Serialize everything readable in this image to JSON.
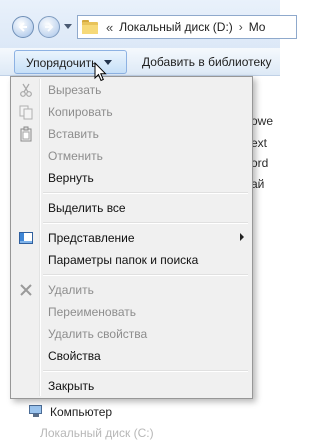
{
  "address": {
    "chevrons": "«",
    "disk_label": "Локальный диск (D:)",
    "arrow": "›",
    "next_partial": "Mo"
  },
  "toolbar": {
    "organize_label": "Упорядочить",
    "library_label": "Добавить в библиотеку"
  },
  "menu": {
    "cut": "Вырезать",
    "copy": "Копировать",
    "paste": "Вставить",
    "undo": "Отменить",
    "redo": "Вернуть",
    "select_all": "Выделить все",
    "view": "Представление",
    "folder_options": "Параметры папок и поиска",
    "delete": "Удалить",
    "rename": "Переименовать",
    "remove_properties": "Удалить свойства",
    "properties": "Свойства",
    "close": "Закрыть"
  },
  "background": {
    "right_fragments": [
      "owe",
      "ext",
      "ord",
      "ай"
    ],
    "computer_label": "Компьютер",
    "faded_row": "Локальный диск (C:)"
  },
  "icons": {
    "cut": "scissors-icon",
    "copy": "copy-icon",
    "paste": "clipboard-icon",
    "view": "layout-icon",
    "delete": "delete-x-icon"
  }
}
